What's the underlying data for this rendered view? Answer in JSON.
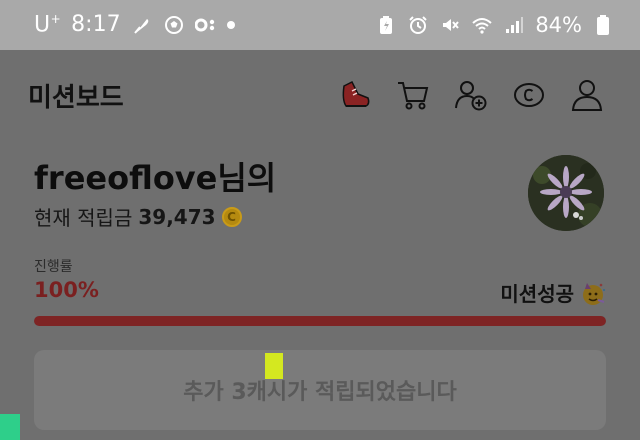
{
  "status_bar": {
    "carrier": "U",
    "carrier_sup": "+",
    "time": "8:17",
    "battery": "84%",
    "icons": [
      "feather-icon",
      "soccer-ball-icon",
      "glasses-icon",
      "dot-icon",
      "battery-saver-icon",
      "alarm-icon",
      "mute-icon",
      "wifi-icon",
      "signal-icon",
      "battery-icon"
    ]
  },
  "header": {
    "title": "미션보드",
    "icons": [
      "shoe-icon",
      "cart-icon",
      "add-friend-icon",
      "coin-c-icon",
      "profile-icon"
    ]
  },
  "profile": {
    "username": "freeoflove님의",
    "balance_label": "현재 적립금",
    "balance_value": "39,473",
    "coin_symbol": "C"
  },
  "progress": {
    "label": "진행률",
    "value_text": "100%",
    "fraction": 1.0,
    "status": "미션성공",
    "status_icon": "party-face-icon"
  },
  "notice": {
    "text": "추가 3캐시가 적립되었습니다"
  },
  "colors": {
    "overlay_bg": "#6f6f6f",
    "status_bar_bg": "#a9a9a9",
    "progress_accent": "#7e2424"
  }
}
